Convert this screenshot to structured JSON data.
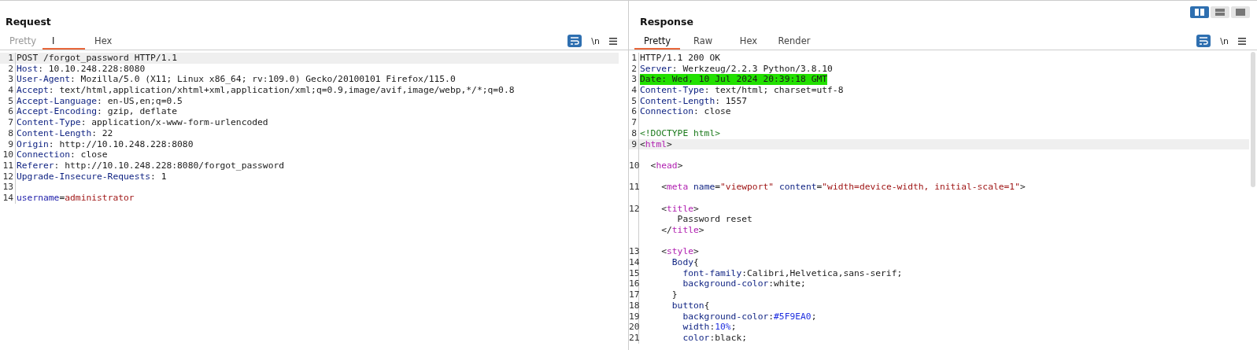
{
  "layout_toggle": [
    {
      "selected": true
    },
    {
      "selected": false
    },
    {
      "selected": false
    }
  ],
  "panels": [
    {
      "title": "Request",
      "tabs": [
        {
          "label": "Pretty",
          "selected": false,
          "disabled": true
        },
        {
          "label": "I",
          "selected": true,
          "disabled": false
        },
        {
          "label": "Hex",
          "selected": false,
          "disabled": false
        }
      ],
      "newline_toggle": "\\n",
      "rows": [
        {
          "kind": "line",
          "number": "1",
          "current": true,
          "marked": false,
          "tokens": [
            {
              "kind": "plain",
              "t": "POST /forgot_password HTTP/1.1"
            }
          ]
        },
        {
          "kind": "line",
          "number": "2",
          "current": false,
          "marked": false,
          "tokens": [
            {
              "kind": "key",
              "t": "Host"
            },
            {
              "kind": "plain",
              "t": ": 10.10.248.228:8080"
            }
          ]
        },
        {
          "kind": "line",
          "number": "3",
          "current": false,
          "marked": false,
          "tokens": [
            {
              "kind": "key",
              "t": "User-Agent"
            },
            {
              "kind": "plain",
              "t": ": Mozilla/5.0 (X11; Linux x86_64; rv:109.0) Gecko/20100101 Firefox/115.0"
            }
          ]
        },
        {
          "kind": "line",
          "number": "4",
          "current": false,
          "marked": false,
          "tokens": [
            {
              "kind": "key",
              "t": "Accept"
            },
            {
              "kind": "plain",
              "t": ": text/html,application/xhtml+xml,application/xml;q=0.9,image/avif,image/webp,*/*;q=0.8"
            }
          ]
        },
        {
          "kind": "line",
          "number": "5",
          "current": false,
          "marked": false,
          "tokens": [
            {
              "kind": "key",
              "t": "Accept-Language"
            },
            {
              "kind": "plain",
              "t": ": en-US,en;q=0.5"
            }
          ]
        },
        {
          "kind": "line",
          "number": "6",
          "current": false,
          "marked": false,
          "tokens": [
            {
              "kind": "key",
              "t": "Accept-Encoding"
            },
            {
              "kind": "plain",
              "t": ": gzip, deflate"
            }
          ]
        },
        {
          "kind": "line",
          "number": "7",
          "current": false,
          "marked": false,
          "tokens": [
            {
              "kind": "key",
              "t": "Content-Type"
            },
            {
              "kind": "plain",
              "t": ": application/x-www-form-urlencoded"
            }
          ]
        },
        {
          "kind": "line",
          "number": "8",
          "current": false,
          "marked": false,
          "tokens": [
            {
              "kind": "key",
              "t": "Content-Length"
            },
            {
              "kind": "plain",
              "t": ": 22"
            }
          ]
        },
        {
          "kind": "line",
          "number": "9",
          "current": false,
          "marked": false,
          "tokens": [
            {
              "kind": "key",
              "t": "Origin"
            },
            {
              "kind": "plain",
              "t": ": http://10.10.248.228:8080"
            }
          ]
        },
        {
          "kind": "line",
          "number": "10",
          "current": false,
          "marked": false,
          "tokens": [
            {
              "kind": "key",
              "t": "Connection"
            },
            {
              "kind": "plain",
              "t": ": close"
            }
          ]
        },
        {
          "kind": "line",
          "number": "11",
          "current": false,
          "marked": false,
          "tokens": [
            {
              "kind": "key",
              "t": "Referer"
            },
            {
              "kind": "plain",
              "t": ": http://10.10.248.228:8080/forgot_password"
            }
          ]
        },
        {
          "kind": "line",
          "number": "12",
          "current": false,
          "marked": false,
          "tokens": [
            {
              "kind": "key",
              "t": "Upgrade-Insecure-Requests"
            },
            {
              "kind": "plain",
              "t": ": 1"
            }
          ]
        },
        {
          "kind": "line",
          "number": "13",
          "current": false,
          "marked": false
        },
        {
          "kind": "line",
          "number": "14",
          "current": false,
          "marked": false,
          "tokens": [
            {
              "kind": "param",
              "t": "username"
            },
            {
              "kind": "plain",
              "t": "="
            },
            {
              "kind": "string",
              "t": "administrator"
            }
          ]
        }
      ]
    },
    {
      "title": "Response",
      "tabs": [
        {
          "label": "Pretty",
          "selected": true,
          "disabled": false
        },
        {
          "label": "Raw",
          "selected": false,
          "disabled": false
        },
        {
          "label": "Hex",
          "selected": false,
          "disabled": false
        },
        {
          "label": "Render",
          "selected": false,
          "disabled": false
        }
      ],
      "newline_toggle": "\\n",
      "rows": [
        {
          "kind": "line",
          "number": "1",
          "current": false,
          "marked": false,
          "tokens": [
            {
              "kind": "plain",
              "t": "HTTP/1.1 200 OK"
            }
          ]
        },
        {
          "kind": "line",
          "number": "2",
          "current": false,
          "marked": false,
          "tokens": [
            {
              "kind": "key",
              "t": "Server"
            },
            {
              "kind": "plain",
              "t": ": Werkzeug/2.2.3 Python/3.8.10"
            }
          ]
        },
        {
          "kind": "line",
          "number": "3",
          "current": false,
          "marked": true,
          "tokens": [
            {
              "kind": "plain",
              "t": "Date: Wed, 10 Jul 2024 20:39:18 GMT"
            }
          ]
        },
        {
          "kind": "line",
          "number": "4",
          "current": false,
          "marked": false,
          "tokens": [
            {
              "kind": "key",
              "t": "Content-Type"
            },
            {
              "kind": "plain",
              "t": ": text/html; charset=utf-8"
            }
          ]
        },
        {
          "kind": "line",
          "number": "5",
          "current": false,
          "marked": false,
          "tokens": [
            {
              "kind": "key",
              "t": "Content-Length"
            },
            {
              "kind": "plain",
              "t": ": 1557"
            }
          ]
        },
        {
          "kind": "line",
          "number": "6",
          "current": false,
          "marked": false,
          "tokens": [
            {
              "kind": "key",
              "t": "Connection"
            },
            {
              "kind": "plain",
              "t": ": close"
            }
          ]
        },
        {
          "kind": "line",
          "number": "7",
          "current": false,
          "marked": false
        },
        {
          "kind": "line",
          "number": "8",
          "current": false,
          "marked": false,
          "tokens": [
            {
              "kind": "doctype",
              "t": "<!DOCTYPE html>"
            }
          ]
        },
        {
          "kind": "line",
          "number": "9",
          "current": true,
          "marked": false,
          "tokens": [
            {
              "kind": "plain",
              "t": "<"
            },
            {
              "kind": "tag",
              "t": "html"
            },
            {
              "kind": "plain",
              "t": ">"
            }
          ]
        },
        {
          "kind": "blank"
        },
        {
          "kind": "line",
          "number": "10",
          "current": false,
          "marked": false,
          "tokens": [
            {
              "kind": "plain",
              "t": "  <"
            },
            {
              "kind": "tag",
              "t": "head"
            },
            {
              "kind": "plain",
              "t": ">"
            }
          ]
        },
        {
          "kind": "blank"
        },
        {
          "kind": "line",
          "number": "11",
          "current": false,
          "marked": false,
          "tokens": [
            {
              "kind": "plain",
              "t": "    <"
            },
            {
              "kind": "tag",
              "t": "meta"
            },
            {
              "kind": "attr",
              "t": " name"
            },
            {
              "kind": "plain",
              "t": "="
            },
            {
              "kind": "string",
              "t": "\"viewport\""
            },
            {
              "kind": "attr",
              "t": " content"
            },
            {
              "kind": "plain",
              "t": "="
            },
            {
              "kind": "string",
              "t": "\"width=device-width, initial-scale=1\""
            },
            {
              "kind": "plain",
              "t": ">"
            }
          ]
        },
        {
          "kind": "blank"
        },
        {
          "kind": "line",
          "number": "12",
          "current": false,
          "marked": false,
          "tokens": [
            {
              "kind": "plain",
              "t": "    <"
            },
            {
              "kind": "tag",
              "t": "title"
            },
            {
              "kind": "plain",
              "t": ">"
            }
          ]
        },
        {
          "kind": "wrap",
          "current": false,
          "marked": false,
          "tokens": [
            {
              "kind": "plain",
              "t": "       Password reset"
            }
          ]
        },
        {
          "kind": "wrap",
          "current": false,
          "marked": false,
          "tokens": [
            {
              "kind": "plain",
              "t": "    </"
            },
            {
              "kind": "tag",
              "t": "title"
            },
            {
              "kind": "plain",
              "t": ">"
            }
          ]
        },
        {
          "kind": "blank"
        },
        {
          "kind": "line",
          "number": "13",
          "current": false,
          "marked": false,
          "tokens": [
            {
              "kind": "plain",
              "t": "    <"
            },
            {
              "kind": "tag",
              "t": "style"
            },
            {
              "kind": "plain",
              "t": ">"
            }
          ]
        },
        {
          "kind": "line",
          "number": "14",
          "current": false,
          "marked": false,
          "tokens": [
            {
              "kind": "key",
              "t": "      Body"
            },
            {
              "kind": "plain",
              "t": "{"
            }
          ]
        },
        {
          "kind": "line",
          "number": "15",
          "current": false,
          "marked": false,
          "tokens": [
            {
              "kind": "key",
              "t": "        font-family"
            },
            {
              "kind": "plain",
              "t": ":Calibri,Helvetica,sans-serif;"
            }
          ]
        },
        {
          "kind": "line",
          "number": "16",
          "current": false,
          "marked": false,
          "tokens": [
            {
              "kind": "key",
              "t": "        background-color"
            },
            {
              "kind": "plain",
              "t": ":white;"
            }
          ]
        },
        {
          "kind": "line",
          "number": "17",
          "current": false,
          "marked": false,
          "tokens": [
            {
              "kind": "plain",
              "t": "      }"
            }
          ]
        },
        {
          "kind": "line",
          "number": "18",
          "current": false,
          "marked": false,
          "tokens": [
            {
              "kind": "key",
              "t": "      button"
            },
            {
              "kind": "plain",
              "t": "{"
            }
          ]
        },
        {
          "kind": "line",
          "number": "19",
          "current": false,
          "marked": false,
          "tokens": [
            {
              "kind": "key",
              "t": "        background-color"
            },
            {
              "kind": "plain",
              "t": ":"
            },
            {
              "kind": "num",
              "t": "#5F9EA0"
            },
            {
              "kind": "plain",
              "t": ";"
            }
          ]
        },
        {
          "kind": "line",
          "number": "20",
          "current": false,
          "marked": false,
          "tokens": [
            {
              "kind": "key",
              "t": "        width"
            },
            {
              "kind": "plain",
              "t": ":"
            },
            {
              "kind": "num",
              "t": "10%"
            },
            {
              "kind": "plain",
              "t": ";"
            }
          ]
        },
        {
          "kind": "line",
          "number": "21",
          "current": false,
          "marked": false,
          "tokens": [
            {
              "kind": "key",
              "t": "        color"
            },
            {
              "kind": "plain",
              "t": ":black;"
            }
          ]
        }
      ]
    }
  ]
}
